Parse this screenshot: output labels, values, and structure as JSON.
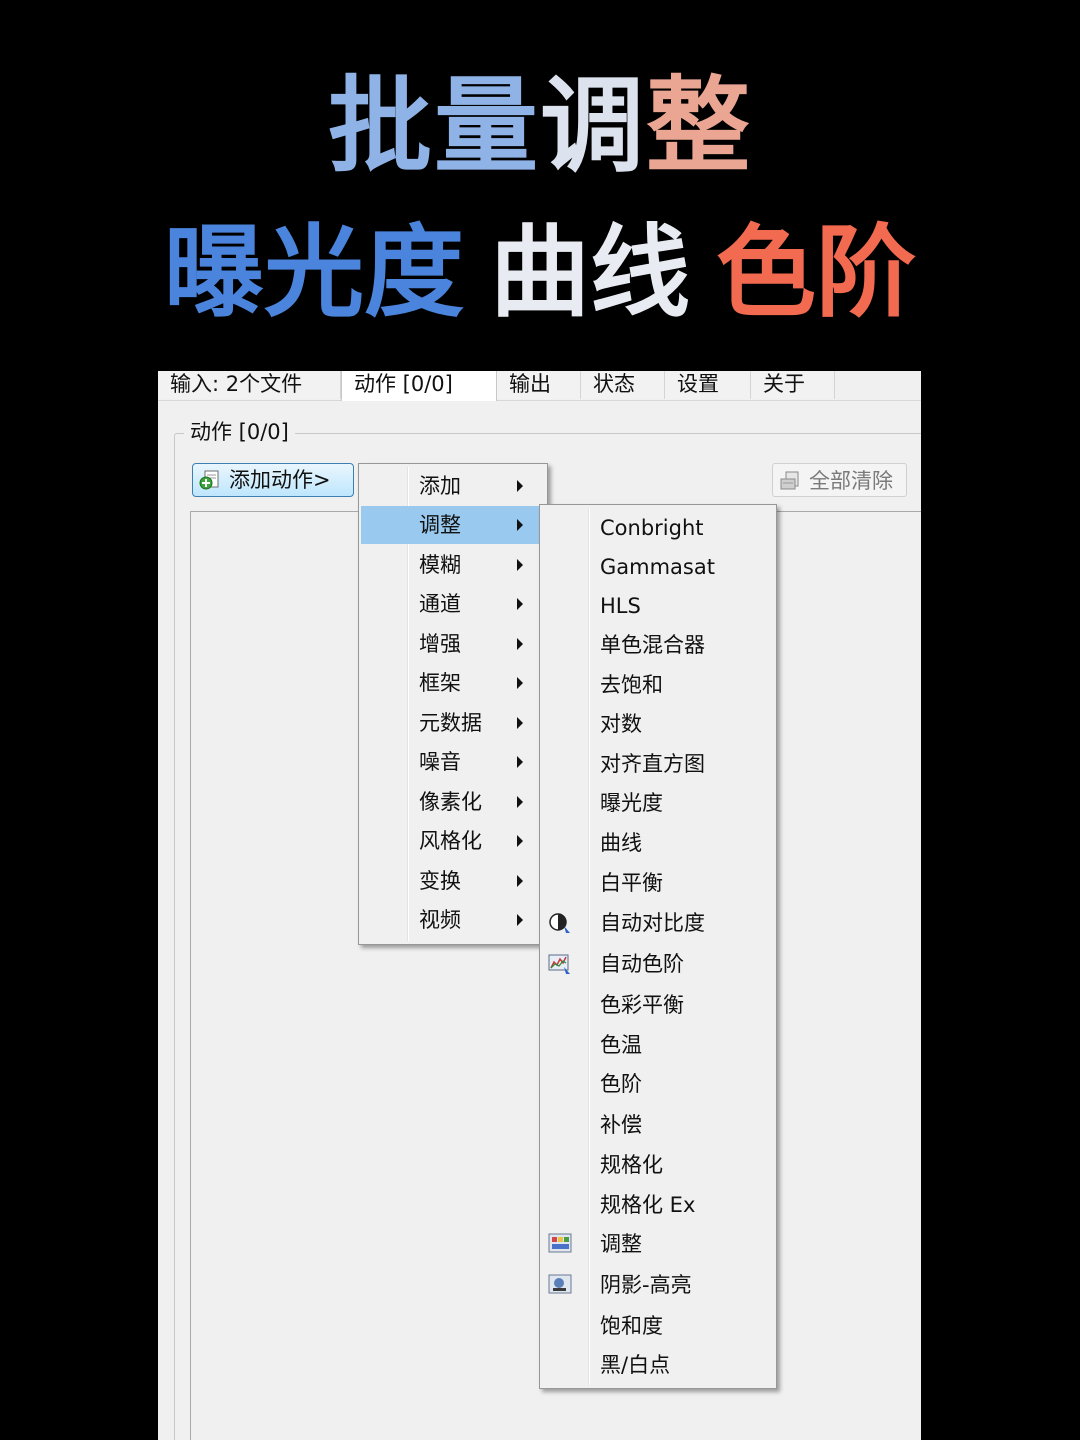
{
  "headline": {
    "line1": [
      {
        "text": "批量",
        "color": "#8fb3e6"
      },
      {
        "text": "调",
        "color": "#dde3ee"
      },
      {
        "text": "整",
        "color": "#eaa692"
      }
    ],
    "line2": [
      {
        "text": "曝光度",
        "color": "#4a84dd"
      },
      {
        "text": "曲线",
        "color": "#e8ecf2"
      },
      {
        "text": "色阶",
        "color": "#f26a4f"
      }
    ]
  },
  "tabs": [
    {
      "label": "输入: 2个文件"
    },
    {
      "label": "动作 [0/0]",
      "active": true
    },
    {
      "label": "输出"
    },
    {
      "label": "状态"
    },
    {
      "label": "设置"
    },
    {
      "label": "关于"
    }
  ],
  "group_label": "动作 [0/0]",
  "add_button": "添加动作>",
  "clear_button": "全部清除",
  "menu1": {
    "items": [
      {
        "label": "添加",
        "submenu": true
      },
      {
        "label": "调整",
        "submenu": true,
        "highlighted": true
      },
      {
        "label": "模糊",
        "submenu": true
      },
      {
        "label": "通道",
        "submenu": true
      },
      {
        "label": "增强",
        "submenu": true
      },
      {
        "label": "框架",
        "submenu": true
      },
      {
        "label": "元数据",
        "submenu": true
      },
      {
        "label": "噪音",
        "submenu": true
      },
      {
        "label": "像素化",
        "submenu": true
      },
      {
        "label": "风格化",
        "submenu": true
      },
      {
        "label": "变换",
        "submenu": true
      },
      {
        "label": "视频",
        "submenu": true
      }
    ]
  },
  "menu2": {
    "items": [
      {
        "label": "Conbright"
      },
      {
        "label": "Gammasat"
      },
      {
        "label": "HLS"
      },
      {
        "label": "单色混合器"
      },
      {
        "label": "去饱和"
      },
      {
        "label": "对数"
      },
      {
        "label": "对齐直方图"
      },
      {
        "label": "曝光度"
      },
      {
        "label": "曲线"
      },
      {
        "label": "白平衡"
      },
      {
        "label": "自动对比度",
        "icon": "contrast-icon"
      },
      {
        "label": "自动色阶",
        "icon": "levels-icon"
      },
      {
        "label": "色彩平衡"
      },
      {
        "label": "色温"
      },
      {
        "label": "色阶"
      },
      {
        "label": "补偿"
      },
      {
        "label": "规格化"
      },
      {
        "label": "规格化 Ex"
      },
      {
        "label": "调整",
        "icon": "adjust-icon"
      },
      {
        "label": "阴影-高亮",
        "icon": "shadow-highlight-icon"
      },
      {
        "label": "饱和度"
      },
      {
        "label": "黑/白点"
      }
    ]
  }
}
